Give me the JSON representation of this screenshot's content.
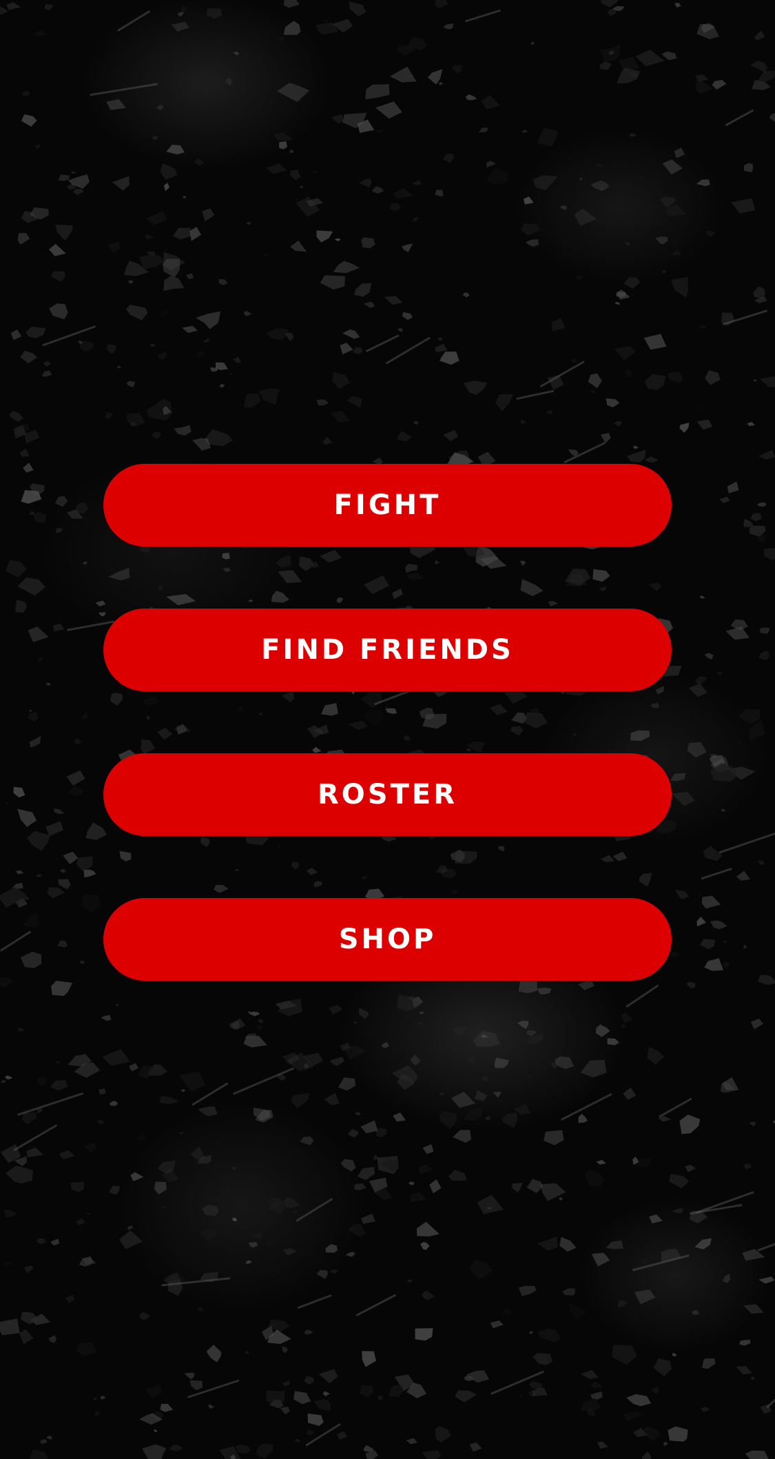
{
  "menu": {
    "accent_color": "#dd0000",
    "text_color": "#ffffff",
    "background": "dark rock texture",
    "buttons": [
      {
        "label": "FIGHT"
      },
      {
        "label": "FIND FRIENDS"
      },
      {
        "label": "ROSTER"
      },
      {
        "label": "SHOP"
      }
    ]
  }
}
